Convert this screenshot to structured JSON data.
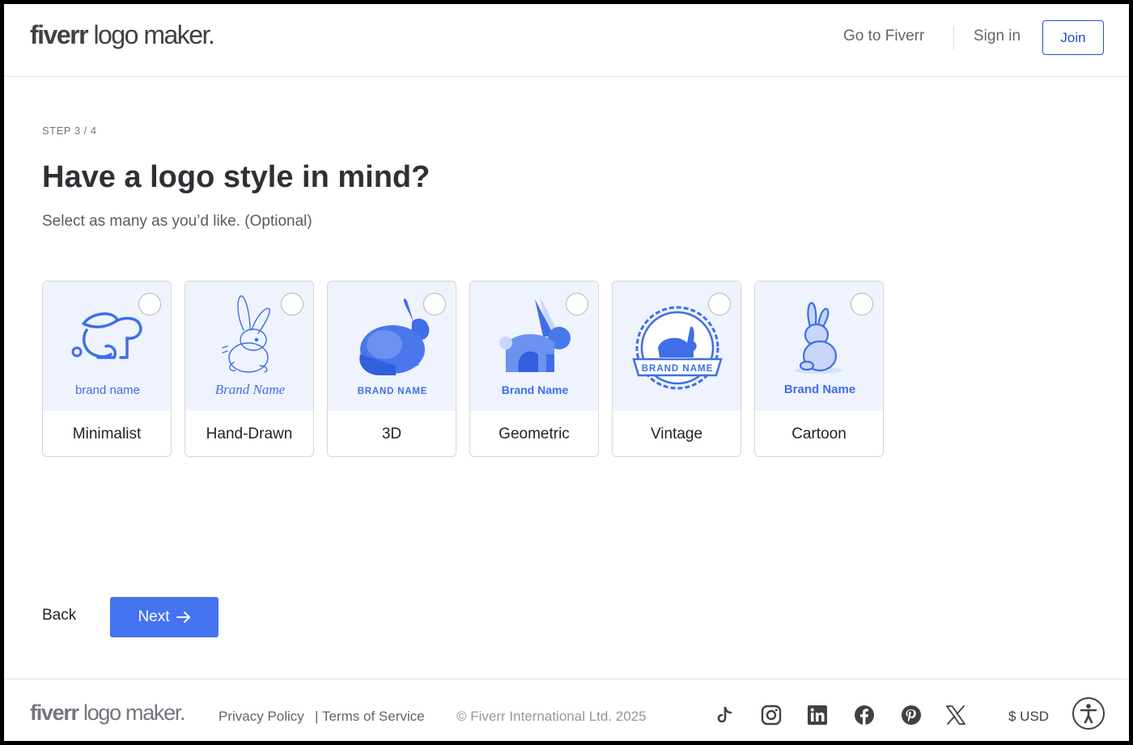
{
  "header": {
    "logo_brand": "fiverr",
    "logo_rest": " logo maker.",
    "go_to_fiverr": "Go to Fiverr",
    "sign_in": "Sign in",
    "join": "Join"
  },
  "main": {
    "step": "STEP 3 / 4",
    "title": "Have a logo style in mind?",
    "subtitle": "Select as many as you’d like. (Optional)",
    "styles": [
      {
        "label": "Minimalist",
        "sample": "brand name",
        "icon": "rabbit-line-icon"
      },
      {
        "label": "Hand-Drawn",
        "sample": "Brand Name",
        "icon": "rabbit-sketch-icon"
      },
      {
        "label": "3D",
        "sample": "BRAND NAME",
        "icon": "rabbit-3d-icon"
      },
      {
        "label": "Geometric",
        "sample": "Brand Name",
        "icon": "rabbit-geometric-icon"
      },
      {
        "label": "Vintage",
        "sample": "BRAND NAME",
        "icon": "rabbit-badge-icon"
      },
      {
        "label": "Cartoon",
        "sample": "Brand Name",
        "icon": "rabbit-cartoon-icon"
      }
    ],
    "back": "Back",
    "next": "Next"
  },
  "footer": {
    "logo_brand": "fiverr",
    "logo_rest": " logo maker.",
    "privacy": "Privacy Policy",
    "separator": "|",
    "terms": "Terms of Service",
    "copyright": "© Fiverr International Ltd. 2025",
    "social": [
      "tiktok-icon",
      "instagram-icon",
      "linkedin-icon",
      "facebook-icon",
      "pinterest-icon",
      "x-icon"
    ],
    "currency": "$ USD"
  },
  "colors": {
    "accent": "#4573ef",
    "link_blue": "#1d4fd8",
    "card_bg": "#eef3fe",
    "illustration": "#3f6ee6"
  }
}
